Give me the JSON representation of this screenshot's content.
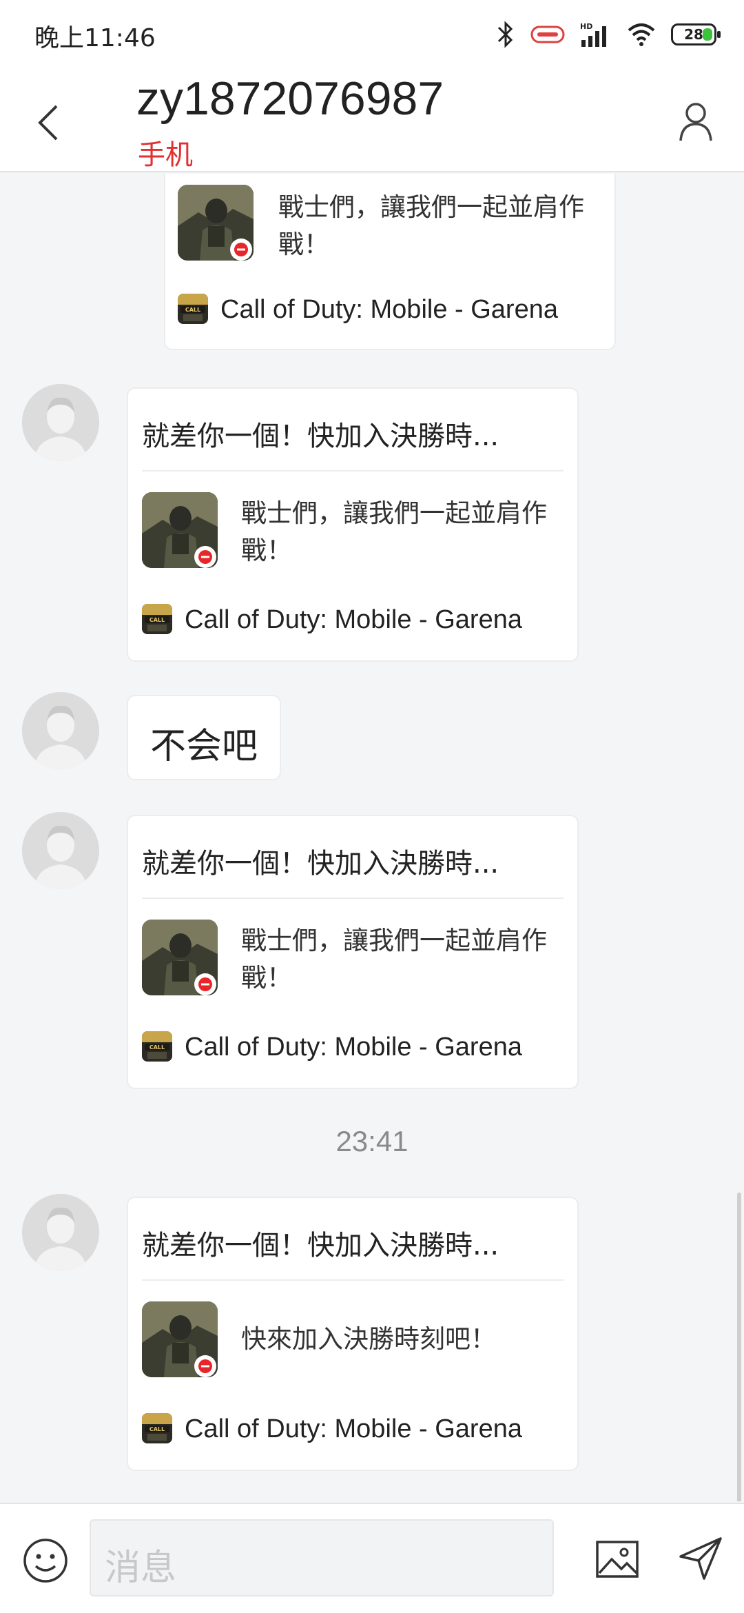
{
  "status_bar": {
    "time": "晚上11:46",
    "battery": "28",
    "icons": [
      "bluetooth-icon",
      "toggle-icon",
      "hd-signal-icon",
      "wifi-icon",
      "battery-icon"
    ]
  },
  "header": {
    "title": "zy1872076987",
    "subtitle": "手机",
    "back_icon": "chevron-left-icon",
    "contact_icon": "person-icon"
  },
  "messages": [
    {
      "type": "card",
      "partial": true,
      "description": "戰士們，讓我們一起並肩作戰！",
      "source": "Call of Duty: Mobile - Garena"
    },
    {
      "type": "card",
      "title": "就差你一個！快加入決勝時...",
      "description": "戰士們，讓我們一起並肩作戰！",
      "source": "Call of Duty: Mobile - Garena"
    },
    {
      "type": "text",
      "text": "不会吧"
    },
    {
      "type": "card",
      "title": "就差你一個！快加入決勝時...",
      "description": "戰士們，讓我們一起並肩作戰！",
      "source": "Call of Duty: Mobile - Garena"
    },
    {
      "type": "timestamp",
      "text": "23:41"
    },
    {
      "type": "card",
      "title": "就差你一個！快加入決勝時...",
      "description": "快來加入決勝時刻吧！",
      "source": "Call of Duty: Mobile - Garena"
    }
  ],
  "input_bar": {
    "placeholder": "消息",
    "emoji_icon": "smiley-icon",
    "image_icon": "image-icon",
    "send_icon": "send-icon"
  },
  "colors": {
    "accent": "#e03030",
    "background": "#f4f5f6"
  }
}
